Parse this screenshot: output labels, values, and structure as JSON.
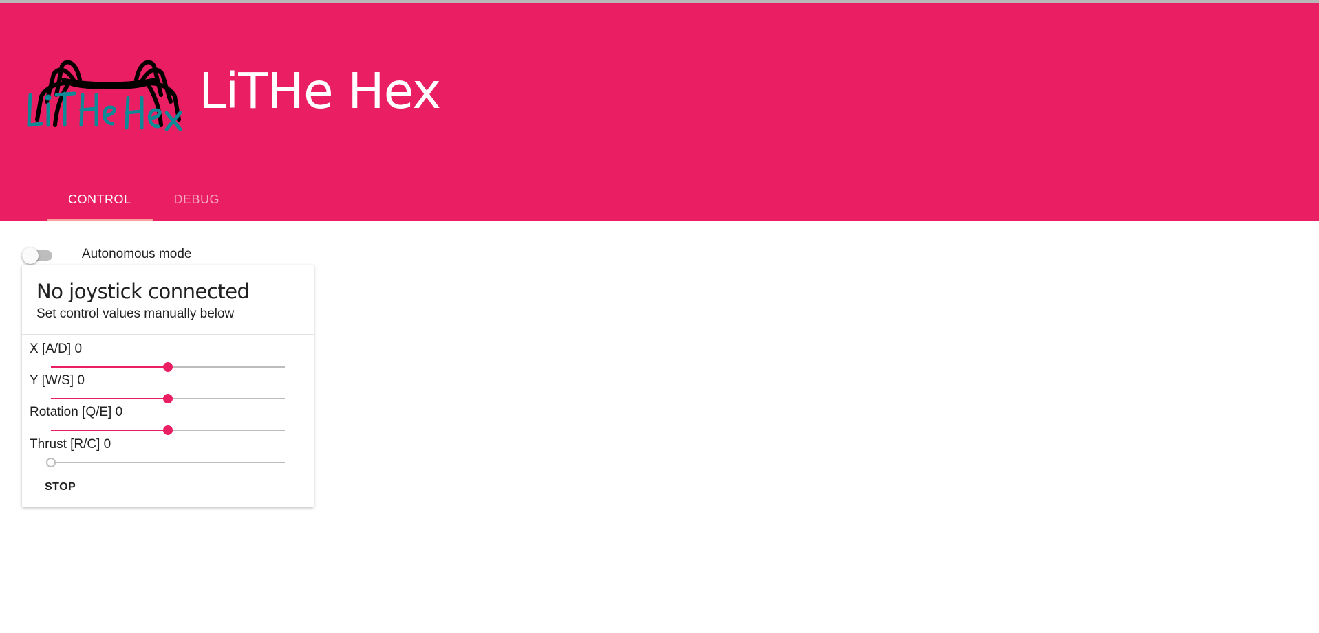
{
  "app": {
    "title": "LiTHe Hex",
    "logo": {
      "icon": "spider-logo-icon",
      "text": "LiTHe Hex"
    }
  },
  "colors": {
    "primary": "#e91e63",
    "tab_indicator": "#ff9f9f",
    "track": "#bdbdbd"
  },
  "tabs": [
    {
      "label": "CONTROL",
      "active": true
    },
    {
      "label": "DEBUG",
      "active": false
    }
  ],
  "autonomous": {
    "label": "Autonomous mode",
    "enabled": false
  },
  "joystick_card": {
    "title": "No joystick connected",
    "subtitle": "Set control values manually below",
    "controls": [
      {
        "label": "X [A/D] 0",
        "value": 0,
        "min": -1,
        "max": 1
      },
      {
        "label": "Y [W/S] 0",
        "value": 0,
        "min": -1,
        "max": 1
      },
      {
        "label": "Rotation [Q/E] 0",
        "value": 0,
        "min": -1,
        "max": 1
      },
      {
        "label": "Thrust [R/C] 0",
        "value": 0,
        "min": 0,
        "max": 1
      }
    ],
    "stop_label": "STOP"
  }
}
